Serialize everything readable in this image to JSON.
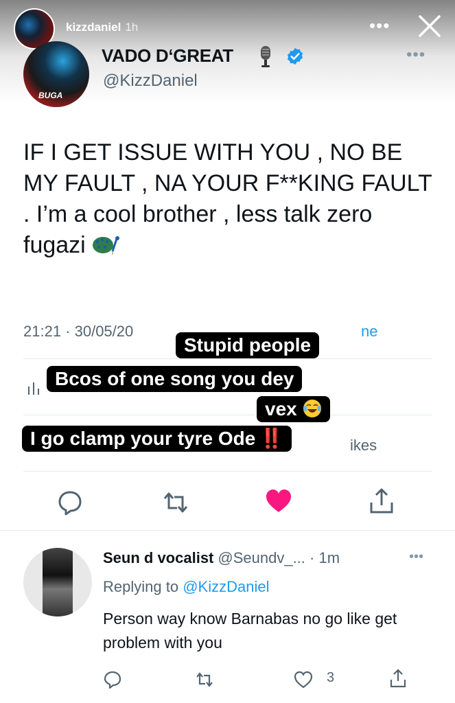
{
  "story": {
    "username": "kizzdaniel",
    "time": "1h",
    "more": "•••"
  },
  "tweet": {
    "display_name": "VADO D‘GREAT",
    "handle": "@KizzDaniel",
    "text": "IF I GET ISSUE WITH YOU , NO BE MY FAULT , NA YOUR F**KING FAULT . I’m a cool brother , less talk zero fugazi",
    "timestamp": "21:21 · 30/05/20",
    "source_tail": "ne",
    "likes_partial": "ikes",
    "more": "•••",
    "avatar_badge": "BUGA"
  },
  "captions": [
    "Stupid people",
    "Bcos of one song you dey",
    "vex",
    "I go clamp your tyre Ode"
  ],
  "caption_marks": "‼️",
  "reply": {
    "name": "Seun d vocalist",
    "handle": "@Seundv_... · 1m",
    "more": "•••",
    "replying_prefix": "Replying to",
    "replying_to": "@KizzDaniel",
    "text": "Person way know Barnabas no go like get problem with you",
    "like_count": "3"
  },
  "colors": {
    "accent": "#1d9bf0",
    "like_active": "#f91880",
    "caption_bg": "#000000"
  }
}
